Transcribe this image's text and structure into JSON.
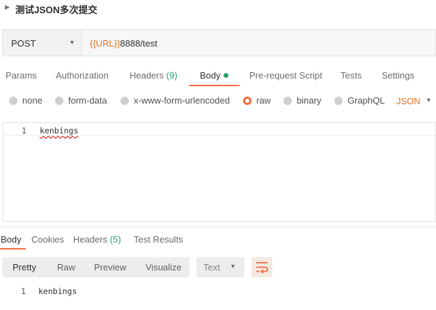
{
  "request": {
    "title": "测试JSON多次提交",
    "method": "POST",
    "url_variable": "{{URL}}",
    "url_rest": "8888/test"
  },
  "request_tabs": [
    {
      "label": "Params"
    },
    {
      "label": "Authorization"
    },
    {
      "label": "Headers",
      "count": "(9)"
    },
    {
      "label": "Body"
    },
    {
      "label": "Pre-request Script"
    },
    {
      "label": "Tests"
    },
    {
      "label": "Settings"
    }
  ],
  "body_types": [
    "none",
    "form-data",
    "x-www-form-urlencoded",
    "raw",
    "binary",
    "GraphQL"
  ],
  "selected_body_type": "raw",
  "raw_format": "JSON",
  "editor": {
    "line_number": "1",
    "content": "kenbings"
  },
  "response_tabs": [
    {
      "label": "Body"
    },
    {
      "label": "Cookies"
    },
    {
      "label": "Headers",
      "count": "(5)"
    },
    {
      "label": "Test Results"
    }
  ],
  "response_view": {
    "options": [
      "Pretty",
      "Raw",
      "Preview",
      "Visualize"
    ],
    "selected": "Pretty",
    "language": "Text"
  },
  "response_body": {
    "line_number": "1",
    "content": "kenbings"
  },
  "colors": {
    "accent": "#f26b3a",
    "variable": "#e8711d",
    "count": "#26a26b"
  }
}
